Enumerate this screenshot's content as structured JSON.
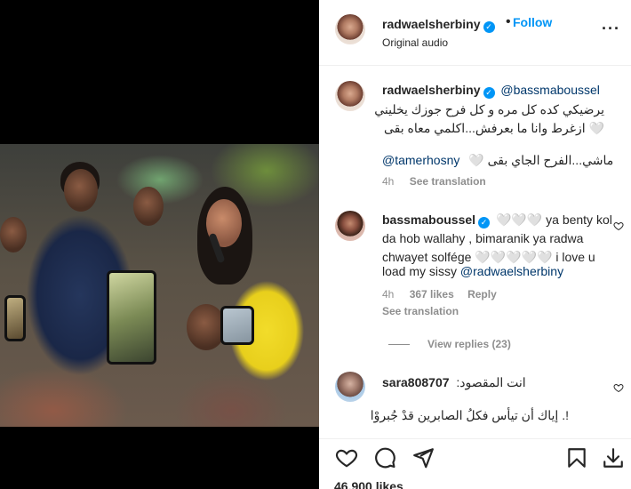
{
  "header": {
    "username": "radwaelsherbiny",
    "separator": "•",
    "follow_label": "Follow",
    "subtitle": "Original audio",
    "more_icon": "more-horizontal-icon"
  },
  "comments": [
    {
      "username": "radwaelsherbiny",
      "mention": "@bassmaboussel",
      "lines": [
        "يرضيكي كده كل مره و كل فرح جوزك يخليني",
        "🤍 ازغرط وانا ما بعرفش...اكلمي معاه بقى"
      ],
      "line2_mention": "@tamerhosny",
      "line2_text": "🤍 ماشي...الفرح الجاي بقى",
      "time": "4h",
      "see_translation": "See translation"
    },
    {
      "username": "bassmaboussel",
      "lines": [
        "🤍🤍🤍 ya benty kol",
        "da hob wallahy , bimaranik ya radwa",
        "chwayet solfége 🤍🤍🤍🤍🤍 i love u",
        "load my sissy"
      ],
      "mention": "@radwaelsherbiny",
      "time": "4h",
      "likes": "367 likes",
      "reply": "Reply",
      "see_translation": "See translation"
    },
    {
      "username": "sara808707",
      "lines": [
        "انت المقصود:",
        "!. إياك أن تيأس فكلُ الصابرين قدْ جُبروْا"
      ]
    }
  ],
  "view_replies": "View replies (23)",
  "likes_count": "46,900 likes",
  "icons": {
    "like": "heart-icon",
    "comment": "comment-icon",
    "share": "send-icon",
    "save": "bookmark-icon",
    "download": "download-icon"
  }
}
